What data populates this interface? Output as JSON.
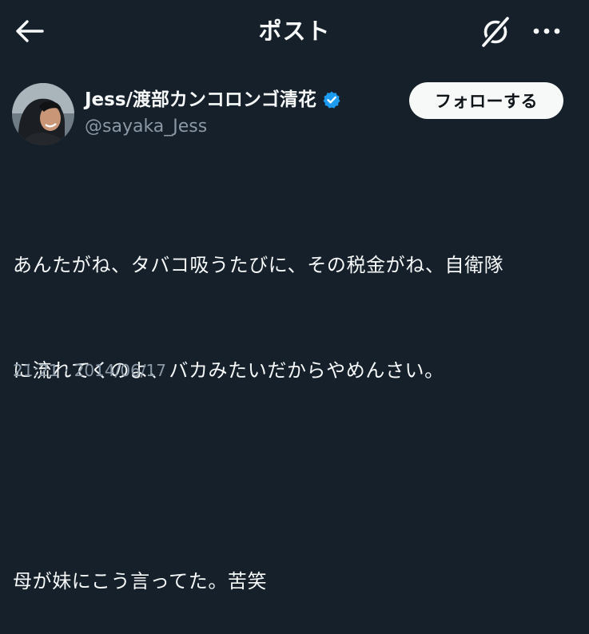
{
  "header": {
    "title": "ポスト",
    "back_icon": "arrow-left-icon",
    "grok_icon": "grok-icon",
    "more_icon": "more-horizontal-icon"
  },
  "author": {
    "display_name": "Jess/渡部カンコロンゴ清花",
    "handle": "@sayaka_Jess",
    "verified": true,
    "verified_color": "#1d9bf0",
    "follow_label": "フォローする"
  },
  "tweet": {
    "lines": [
      "あんたがね、タバコ吸うたびに、その税金がね、自衛隊",
      "に流れてくのよ、バカみたいだからやめんさい。",
      "母が妹にこう言ってた。苦笑"
    ],
    "timestamp": "21:21 · 2014/06/17"
  },
  "colors": {
    "background": "#15202b",
    "text": "#f7f9f9",
    "secondary_text": "#8b98a5"
  }
}
